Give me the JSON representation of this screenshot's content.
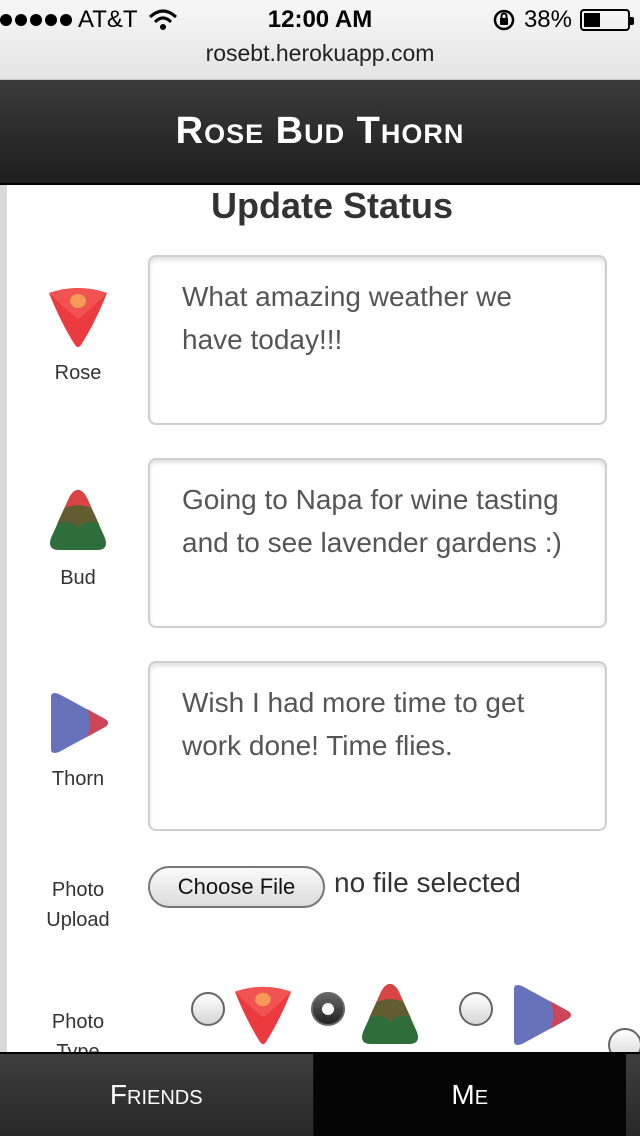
{
  "status_bar": {
    "carrier": "AT&T",
    "time": "12:00 AM",
    "battery_text": "38%",
    "battery_level": 0.38,
    "url": "rosebt.herokuapp.com"
  },
  "header": {
    "title": "Rose Bud Thorn"
  },
  "page": {
    "heading": "Update Status"
  },
  "fields": {
    "rose": {
      "label": "Rose",
      "value": "What amazing weather we have today!!!"
    },
    "bud": {
      "label": "Bud",
      "value": "Going to Napa for wine tasting and to see lavender gardens :)"
    },
    "thorn": {
      "label": "Thorn",
      "value": "Wish I had more time to get work done! Time flies."
    }
  },
  "photo_upload": {
    "label": "Photo Upload",
    "button_label": "Choose File",
    "status": "no file selected"
  },
  "photo_type": {
    "label": "Photo Type",
    "options": [
      {
        "icon": "rose-icon",
        "selected": false
      },
      {
        "icon": "bud-icon",
        "selected": true
      },
      {
        "icon": "thorn-icon",
        "selected": false
      }
    ]
  },
  "tabs": [
    {
      "label": "Friends",
      "active": false
    },
    {
      "label": "Me",
      "active": true
    }
  ],
  "colors": {
    "rose": "#e8383f",
    "bud": "#2e6b3a",
    "thorn": "#6470b8",
    "header": "#2a2a2a"
  }
}
